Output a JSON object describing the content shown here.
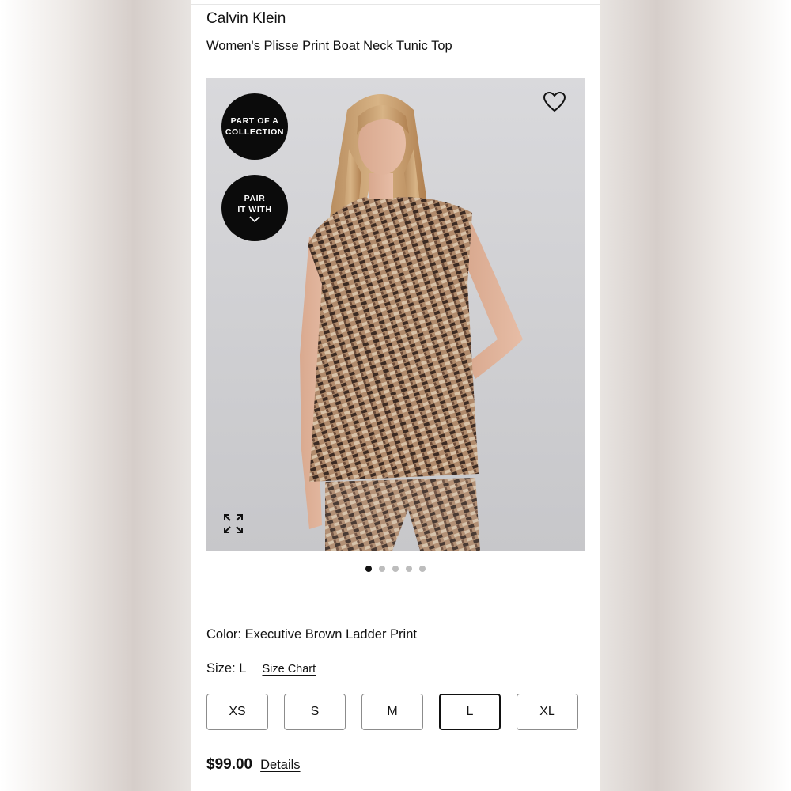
{
  "product": {
    "brand": "Calvin Klein",
    "name": "Women's Plisse Print Boat Neck Tunic Top"
  },
  "badges": {
    "collection_line1": "PART OF A",
    "collection_line2": "COLLECTION",
    "pair_line1": "PAIR",
    "pair_line2": "IT WITH"
  },
  "gallery": {
    "total_images": 5,
    "active_index": 0
  },
  "icons": {
    "wishlist": "heart-icon",
    "expand": "expand-icon",
    "pair_chevron": "chevron-down-icon"
  },
  "color": {
    "text": "Color: Executive Brown Ladder Print"
  },
  "size": {
    "label": "Size: L",
    "chart_link": "Size Chart",
    "options": [
      "XS",
      "S",
      "M",
      "L",
      "XL"
    ],
    "selected": "L"
  },
  "pricing": {
    "price": "$99.00",
    "details_link": "Details"
  },
  "colors": {
    "badge_bg": "#0b0b0b",
    "selected_border": "#111111",
    "inactive_dot": "#bdbdbd"
  }
}
